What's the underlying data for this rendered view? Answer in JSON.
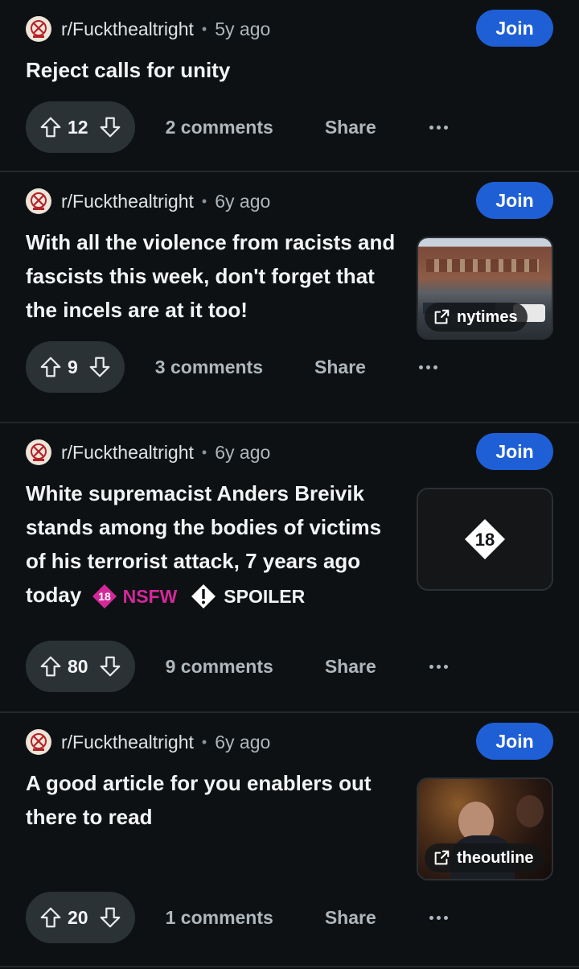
{
  "posts": [
    {
      "subreddit": "r/Fuckthealtright",
      "age": "5y ago",
      "join_label": "Join",
      "title": "Reject calls for unity",
      "score": "12",
      "comments": "2 comments",
      "share": "Share"
    },
    {
      "subreddit": "r/Fuckthealtright",
      "age": "6y ago",
      "join_label": "Join",
      "title": "With all the violence from racists and fascists this week, don't forget that the incels are at it too!",
      "thumb_label": "nytimes",
      "score": "9",
      "comments": "3 comments",
      "share": "Share"
    },
    {
      "subreddit": "r/Fuckthealtright",
      "age": "6y ago",
      "join_label": "Join",
      "title": "White supremacist Anders Breivik stands among the bodies of victims of his terrorist attack, 7 years ago today",
      "nsfw_label": "NSFW",
      "spoiler_label": "SPOILER",
      "thumb_badge": "18",
      "score": "80",
      "comments": "9 comments",
      "share": "Share"
    },
    {
      "subreddit": "r/Fuckthealtright",
      "age": "6y ago",
      "join_label": "Join",
      "title": "A good article for you enablers out there to read",
      "thumb_label": "theoutline",
      "score": "20",
      "comments": "1 comments",
      "share": "Share"
    }
  ],
  "colors": {
    "background": "#0e1113",
    "join_button": "#1f5fd6",
    "vote_pill": "#2a3236",
    "nsfw": "#d4289a"
  },
  "icons": [
    "subreddit-avatar-icon",
    "upvote-icon",
    "downvote-icon",
    "external-link-icon",
    "more-options-icon",
    "nsfw-18-icon",
    "spoiler-icon"
  ]
}
